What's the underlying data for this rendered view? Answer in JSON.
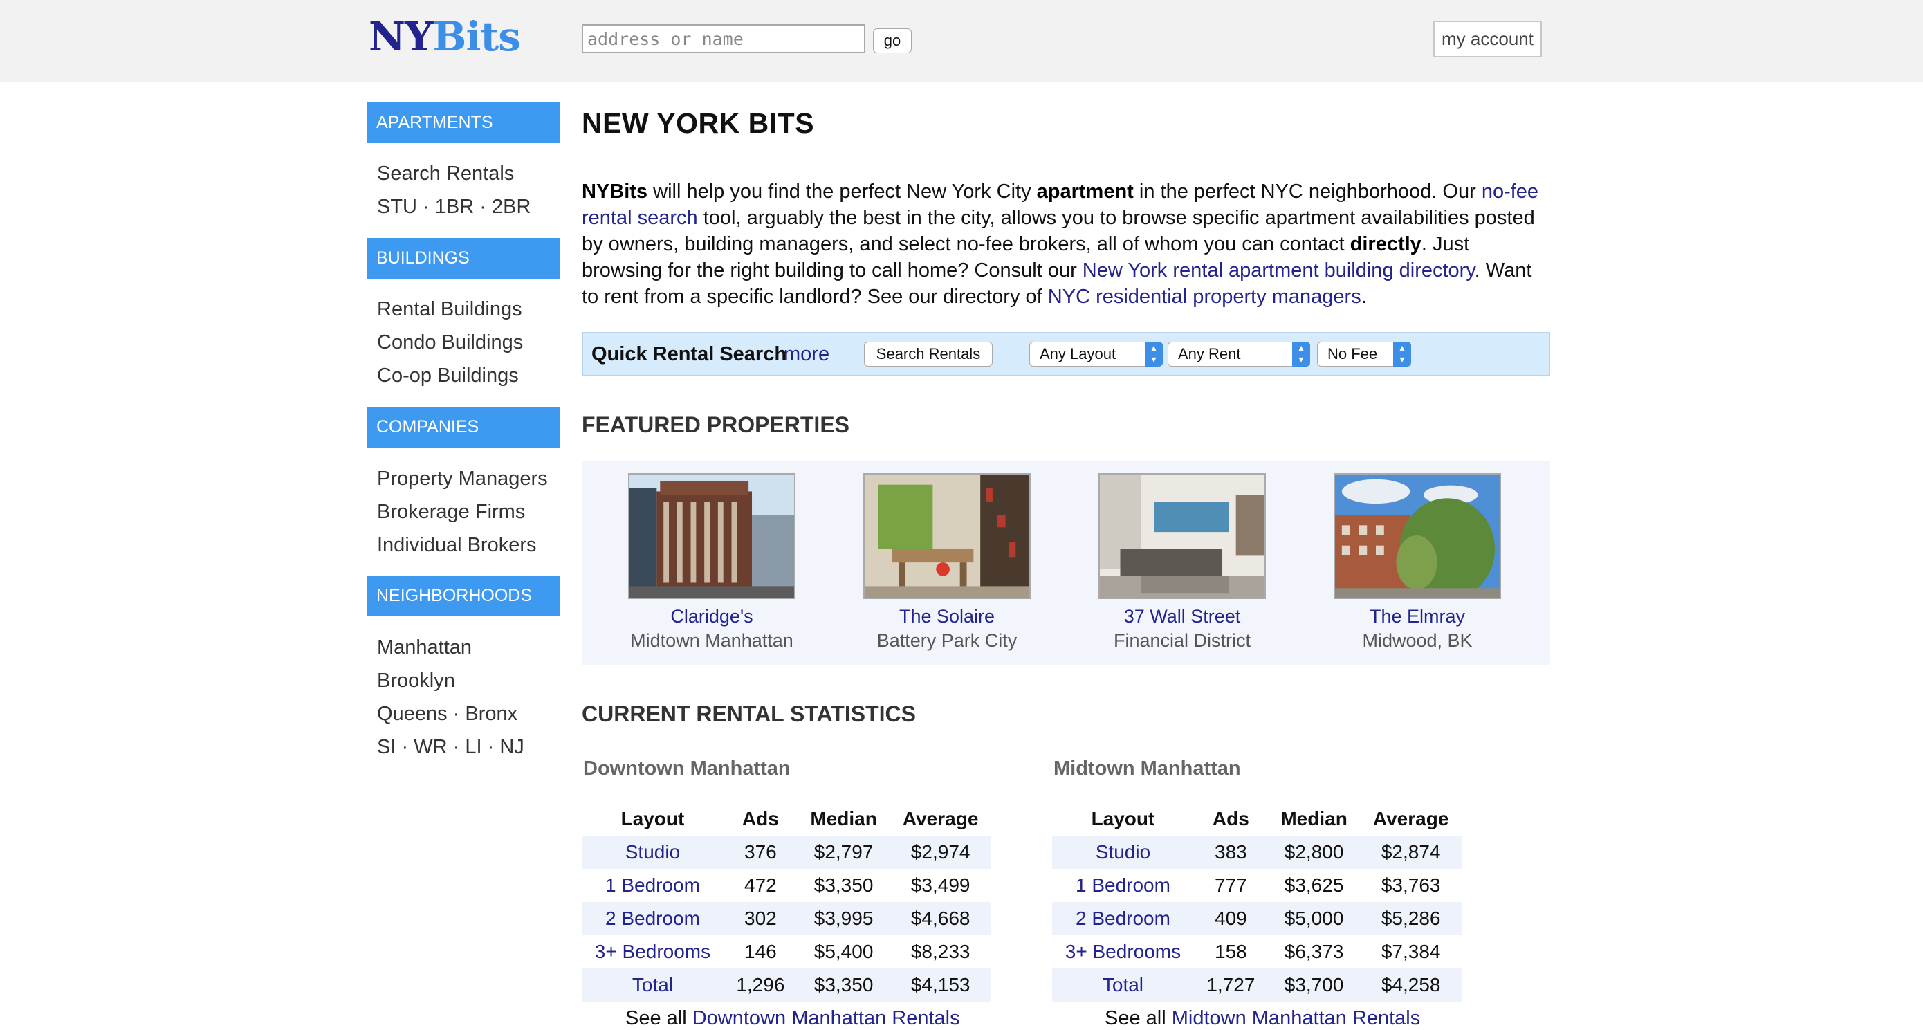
{
  "header": {
    "logo_ny": "NY",
    "logo_bits": "Bits",
    "search_placeholder": "address or name",
    "go_label": "go",
    "account_label": "my account"
  },
  "sidebar": {
    "apartments": {
      "heading": "APARTMENTS",
      "search_rentals": "Search Rentals",
      "stu": "STU",
      "br1": "1BR",
      "br2": "2BR"
    },
    "buildings": {
      "heading": "BUILDINGS",
      "items": [
        "Rental Buildings",
        "Condo Buildings",
        "Co-op Buildings"
      ]
    },
    "companies": {
      "heading": "COMPANIES",
      "items": [
        "Property Managers",
        "Brokerage Firms",
        "Individual Brokers"
      ]
    },
    "neighborhoods": {
      "heading": "NEIGHBORHOODS",
      "manhattan": "Manhattan",
      "brooklyn": "Brooklyn",
      "queens": "Queens",
      "bronx": "Bronx",
      "si": "SI",
      "wr": "WR",
      "li": "LI",
      "nj": "NJ",
      "separator": "·"
    }
  },
  "main": {
    "title": "NEW YORK BITS",
    "intro": {
      "brand": "NYBits",
      "t1": " will help you find the perfect New York City ",
      "b1": "apartment",
      "t2": " in the perfect NYC neighborhood. Our ",
      "link1": "no-fee rental search",
      "t3": " tool, arguably the best in the city, allows you to browse specific apartment availabilities posted by owners, building managers, and select no-fee brokers, all of whom you can contact ",
      "b2": "directly",
      "t4": ". Just browsing for the right building to call home? Consult our ",
      "link2": "New York rental apartment building directory",
      "t5": ". Want to rent from a specific landlord? See our directory of ",
      "link3": "NYC residential property managers",
      "t6": "."
    },
    "quick_search": {
      "title": "Quick Rental Search",
      "more": "more",
      "button": "Search Rentals",
      "layout": "Any Layout",
      "rent": "Any Rent",
      "fee": "No Fee"
    },
    "featured": {
      "title": "FEATURED PROPERTIES",
      "items": [
        {
          "name": "Claridge's",
          "area": "Midtown Manhattan"
        },
        {
          "name": "The Solaire",
          "area": "Battery Park City"
        },
        {
          "name": "37 Wall Street",
          "area": "Financial District"
        },
        {
          "name": "The Elmray",
          "area": "Midwood, BK"
        }
      ]
    },
    "stats": {
      "title": "CURRENT RENTAL STATISTICS",
      "columns": [
        "Layout",
        "Ads",
        "Median",
        "Average"
      ],
      "see_all_prefix": "See all",
      "downtown": {
        "title": "Downtown Manhattan",
        "rows": [
          [
            "Studio",
            "376",
            "$2,797",
            "$2,974"
          ],
          [
            "1 Bedroom",
            "472",
            "$3,350",
            "$3,499"
          ],
          [
            "2 Bedroom",
            "302",
            "$3,995",
            "$4,668"
          ],
          [
            "3+ Bedrooms",
            "146",
            "$5,400",
            "$8,233"
          ],
          [
            "Total",
            "1,296",
            "$3,350",
            "$4,153"
          ]
        ],
        "see_all_link": "Downtown Manhattan Rentals"
      },
      "midtown": {
        "title": "Midtown Manhattan",
        "rows": [
          [
            "Studio",
            "383",
            "$2,800",
            "$2,874"
          ],
          [
            "1 Bedroom",
            "777",
            "$3,625",
            "$3,763"
          ],
          [
            "2 Bedroom",
            "409",
            "$5,000",
            "$5,286"
          ],
          [
            "3+ Bedrooms",
            "158",
            "$6,373",
            "$7,384"
          ],
          [
            "Total",
            "1,727",
            "$3,700",
            "$4,258"
          ]
        ],
        "see_all_link": "Midtown Manhattan Rentals"
      }
    }
  }
}
